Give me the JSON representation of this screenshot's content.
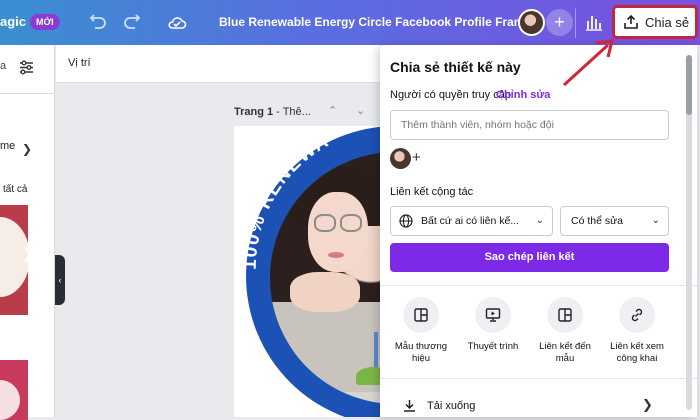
{
  "topbar": {
    "brand_fragment": "agic",
    "new_badge": "MỚI",
    "doc_title": "Blue Renewable Energy Circle Facebook Profile Frame",
    "share_label": "Chia sẻ",
    "colors": {
      "gradient_start": "#3a8fd0",
      "gradient_end": "#7a4fe0"
    }
  },
  "left_panel": {
    "search_fragment": "a",
    "chip_label": "me",
    "see_all_fragment": "tất cả"
  },
  "canvas": {
    "toolbar_label": "Vị trí",
    "page_label_bold": "Trang 1",
    "page_label_rest": " - Thê...",
    "ring_text": "100% RENEWA"
  },
  "share_panel": {
    "title": "Chia sẻ thiết kế này",
    "access_label": "Người có quyền truy cập",
    "access_edit": "Chỉnh sửa",
    "invite_placeholder": "Thêm thành viên, nhóm hoặc đội",
    "link_label": "Liên kết cộng tác",
    "link_scope": "Bất cứ ai có liên kế...",
    "link_permission": "Có thể sửa",
    "copy_button": "Sao chép liên kết",
    "options": [
      {
        "label": "Mẫu thương hiệu",
        "icon": "template-icon"
      },
      {
        "label": "Thuyết trình",
        "icon": "presentation-icon"
      },
      {
        "label": "Liên kết đến mẫu",
        "icon": "template-link-icon"
      },
      {
        "label": "Liên kết xem công khai",
        "icon": "link-icon"
      }
    ],
    "download_label": "Tải xuống",
    "accent_color": "#7d2ae8"
  }
}
